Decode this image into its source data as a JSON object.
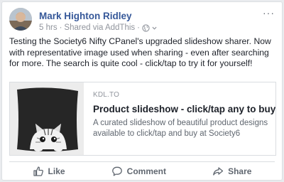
{
  "post": {
    "author": "Mark Highton Ridley",
    "time": "5 hrs",
    "shared_via": "Shared via AddThis",
    "separator": "·",
    "more_label": "···",
    "text": "Testing the Society6 Nifty CPanel's upgraded slideshow sharer. Now with representative image used when sharing - even after searching for more. The search is quite cool - click/tap to try it for yourself!"
  },
  "link": {
    "domain": "KDL.TO",
    "title": "Product slideshow - click/tap any to buy",
    "description": "A curated slideshow of beautiful product designs available to click/tap and buy at Society6"
  },
  "actions": {
    "like": "Like",
    "comment": "Comment",
    "share": "Share"
  },
  "icons": {
    "privacy": "globe-icon",
    "more": "ellipsis-icon",
    "like": "thumbs-up-icon",
    "comment": "speech-bubble-icon",
    "share": "share-arrow-icon"
  },
  "colors": {
    "author_link": "#365899",
    "action_text": "#606770",
    "meta_text": "#90949c"
  }
}
